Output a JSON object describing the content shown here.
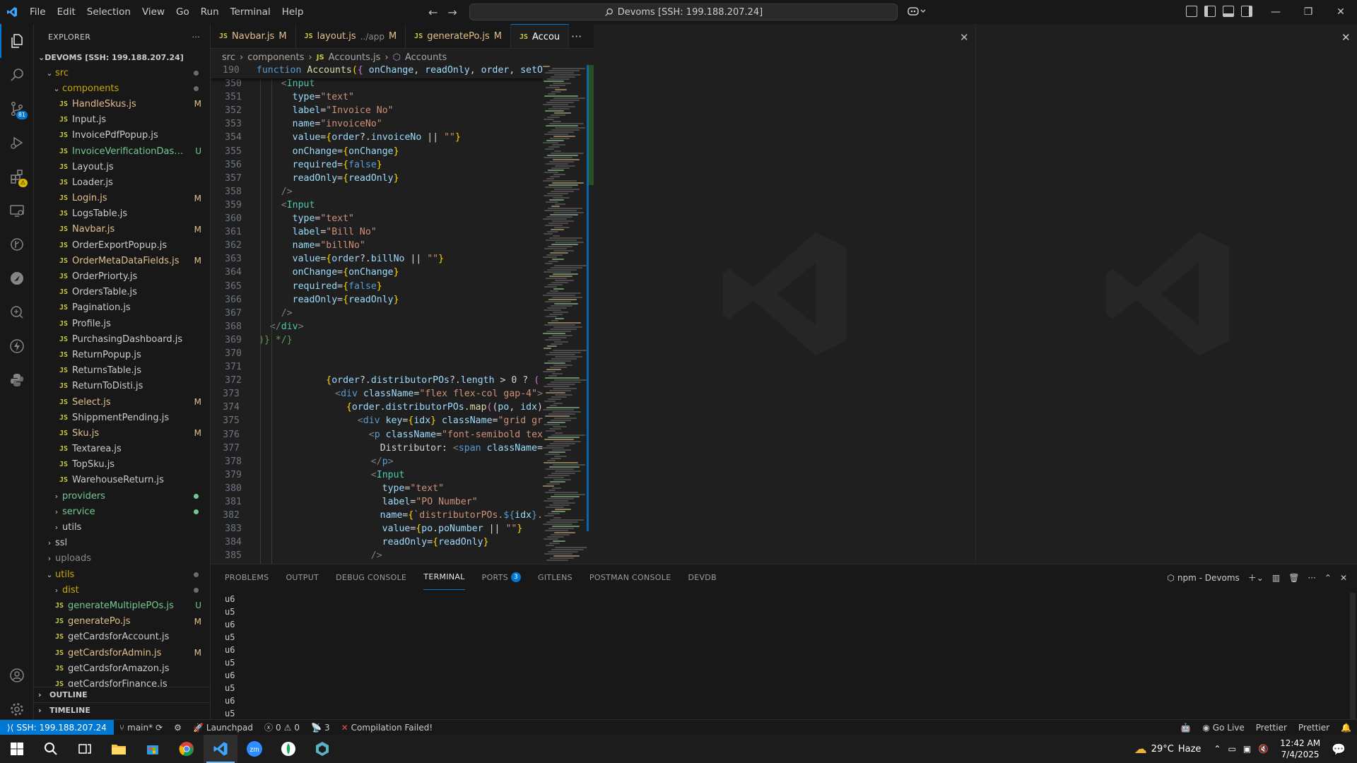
{
  "menu": [
    "File",
    "Edit",
    "Selection",
    "View",
    "Go",
    "Run",
    "Terminal",
    "Help"
  ],
  "command_center": "Devoms [SSH: 199.188.207.24]",
  "activity": {
    "scm_badge": "81"
  },
  "explorer": {
    "title": "EXPLORER",
    "root": "DEVOMS [SSH: 199.188.207.24]",
    "src": "src",
    "components": "components",
    "files": [
      {
        "name": "HandleSkus.js",
        "status": "M",
        "color": "mod"
      },
      {
        "name": "Input.js",
        "status": "",
        "color": "plain"
      },
      {
        "name": "InvoicePdfPopup.js",
        "status": "",
        "color": "plain"
      },
      {
        "name": "InvoiceVerificationDashboa...",
        "status": "U",
        "color": "new"
      },
      {
        "name": "Layout.js",
        "status": "",
        "color": "plain"
      },
      {
        "name": "Loader.js",
        "status": "",
        "color": "plain"
      },
      {
        "name": "Login.js",
        "status": "M",
        "color": "mod"
      },
      {
        "name": "LogsTable.js",
        "status": "",
        "color": "plain"
      },
      {
        "name": "Navbar.js",
        "status": "M",
        "color": "mod"
      },
      {
        "name": "OrderExportPopup.js",
        "status": "",
        "color": "plain"
      },
      {
        "name": "OrderMetaDataFields.js",
        "status": "M",
        "color": "mod"
      },
      {
        "name": "OrderPriorty.js",
        "status": "",
        "color": "plain"
      },
      {
        "name": "OrdersTable.js",
        "status": "",
        "color": "plain"
      },
      {
        "name": "Pagination.js",
        "status": "",
        "color": "plain"
      },
      {
        "name": "Profile.js",
        "status": "",
        "color": "plain"
      },
      {
        "name": "PurchasingDashboard.js",
        "status": "",
        "color": "plain"
      },
      {
        "name": "ReturnPopup.js",
        "status": "",
        "color": "plain"
      },
      {
        "name": "ReturnsTable.js",
        "status": "",
        "color": "plain"
      },
      {
        "name": "ReturnToDisti.js",
        "status": "",
        "color": "plain"
      },
      {
        "name": "Select.js",
        "status": "M",
        "color": "mod"
      },
      {
        "name": "ShippmentPending.js",
        "status": "",
        "color": "plain"
      },
      {
        "name": "Sku.js",
        "status": "M",
        "color": "mod"
      },
      {
        "name": "Textarea.js",
        "status": "",
        "color": "plain"
      },
      {
        "name": "TopSku.js",
        "status": "",
        "color": "plain"
      },
      {
        "name": "WarehouseReturn.js",
        "status": "",
        "color": "plain"
      }
    ],
    "providers": "providers",
    "service": "service",
    "utils_inner": "utils",
    "ssl": "ssl",
    "uploads": "uploads",
    "utils": "utils",
    "dist": "dist",
    "util_files": [
      {
        "name": "generateMultiplePOs.js",
        "status": "U",
        "color": "new"
      },
      {
        "name": "generatePo.js",
        "status": "M",
        "color": "mod"
      },
      {
        "name": "getCardsforAccount.js",
        "status": "",
        "color": "plain"
      },
      {
        "name": "getCardsforAdmin.js",
        "status": "M",
        "color": "mod"
      },
      {
        "name": "getCardsforAmazon.js",
        "status": "",
        "color": "plain"
      },
      {
        "name": "getCardsforFinance.js",
        "status": "",
        "color": "plain"
      }
    ],
    "outline": "OUTLINE",
    "timeline": "TIMELINE"
  },
  "tabs": [
    {
      "label": "Navbar.js",
      "status": "M"
    },
    {
      "label": "layout.js",
      "hint": "../app",
      "status": "M"
    },
    {
      "label": "generatePo.js",
      "status": "M"
    },
    {
      "label": "Accou",
      "status": ""
    }
  ],
  "breadcrumb": [
    "src",
    "components",
    "Accounts.js",
    "Accounts"
  ],
  "code": {
    "sticky_line": "190",
    "lines": [
      {
        "n": "350",
        "html": "    <span class='gray'>&lt;</span><span class='tag'>Input</span>"
      },
      {
        "n": "351",
        "html": "      <span class='attr'>type</span><span class='pun'>=</span><span class='str'>\"text\"</span>"
      },
      {
        "n": "352",
        "html": "      <span class='attr'>label</span><span class='pun'>=</span><span class='str'>\"Invoice No\"</span>"
      },
      {
        "n": "353",
        "html": "      <span class='attr'>name</span><span class='pun'>=</span><span class='str'>\"invoiceNo\"</span>"
      },
      {
        "n": "354",
        "html": "      <span class='attr'>value</span><span class='pun'>=</span><span class='brk2'>{</span><span class='var'>order</span><span class='pun'>?.</span><span class='var'>invoiceNo</span> <span class='pun'>||</span> <span class='str'>\"\"</span><span class='brk2'>}</span>"
      },
      {
        "n": "355",
        "html": "      <span class='attr'>onChange</span><span class='pun'>=</span><span class='brk2'>{</span><span class='var'>onChange</span><span class='brk2'>}</span>"
      },
      {
        "n": "356",
        "html": "      <span class='attr'>required</span><span class='pun'>=</span><span class='brk2'>{</span><span class='kw'>false</span><span class='brk2'>}</span>"
      },
      {
        "n": "357",
        "html": "      <span class='attr'>readOnly</span><span class='pun'>=</span><span class='brk2'>{</span><span class='var'>readOnly</span><span class='brk2'>}</span>"
      },
      {
        "n": "358",
        "html": "    <span class='gray'>/&gt;</span>"
      },
      {
        "n": "359",
        "html": "    <span class='gray'>&lt;</span><span class='tag'>Input</span>"
      },
      {
        "n": "360",
        "html": "      <span class='attr'>type</span><span class='pun'>=</span><span class='str'>\"text\"</span>"
      },
      {
        "n": "361",
        "html": "      <span class='attr'>label</span><span class='pun'>=</span><span class='str'>\"Bill No\"</span>"
      },
      {
        "n": "362",
        "html": "      <span class='attr'>name</span><span class='pun'>=</span><span class='str'>\"billNo\"</span>"
      },
      {
        "n": "363",
        "html": "      <span class='attr'>value</span><span class='pun'>=</span><span class='brk2'>{</span><span class='var'>order</span><span class='pun'>?.</span><span class='var'>billNo</span> <span class='pun'>||</span> <span class='str'>\"\"</span><span class='brk2'>}</span>"
      },
      {
        "n": "364",
        "html": "      <span class='attr'>onChange</span><span class='pun'>=</span><span class='brk2'>{</span><span class='var'>onChange</span><span class='brk2'>}</span>"
      },
      {
        "n": "365",
        "html": "      <span class='attr'>required</span><span class='pun'>=</span><span class='brk2'>{</span><span class='kw'>false</span><span class='brk2'>}</span>"
      },
      {
        "n": "366",
        "html": "      <span class='attr'>readOnly</span><span class='pun'>=</span><span class='brk2'>{</span><span class='var'>readOnly</span><span class='brk2'>}</span>"
      },
      {
        "n": "367",
        "html": "    <span class='gray'>/&gt;</span>"
      },
      {
        "n": "368",
        "html": "  <span class='gray'>&lt;/</span><span class='tag'>div</span><span class='gray'>&gt;</span>"
      },
      {
        "n": "369",
        "html": "<span class='cmt'>)} */}</span>"
      },
      {
        "n": "370",
        "html": ""
      },
      {
        "n": "371",
        "html": ""
      },
      {
        "n": "372",
        "html": "            <span class='brk2'>{</span><span class='var'>order</span><span class='pun'>?.</span><span class='var'>distributorPOs</span><span class='pun'>?.</span><span class='var'>length</span> <span class='pun'>&gt;</span> <span class='pun'>0</span> <span class='pun'>?</span> <span class='brk'>(</span>"
      },
      {
        "n": "373",
        "html": "              <span class='gray'>&lt;</span><span class='kw'>div</span> <span class='attr'>className</span><span class='pun'>=</span><span class='str'>\"flex flex-col gap-4\"</span><span class='gray'>&gt;</span>"
      },
      {
        "n": "374",
        "html": "                <span class='brk2'>{</span><span class='var'>order</span><span class='pun'>.</span><span class='var'>distributorPOs</span><span class='pun'>.</span><span class='fn'>map</span><span class='brk'>(</span><span class='pun'>(</span><span class='var'>po</span><span class='pun'>,</span> <span class='var'>idx</span><span class='pun'>)</span>"
      },
      {
        "n": "375",
        "html": "                  <span class='gray'>&lt;</span><span class='kw'>div</span> <span class='attr'>key</span><span class='pun'>=</span><span class='brk2'>{</span><span class='var'>idx</span><span class='brk2'>}</span> <span class='attr'>className</span><span class='pun'>=</span><span class='str'>\"grid gr</span>"
      },
      {
        "n": "376",
        "html": "                    <span class='gray'>&lt;</span><span class='kw'>p</span> <span class='attr'>className</span><span class='pun'>=</span><span class='str'>\"font-semibold tex</span>"
      },
      {
        "n": "377",
        "html": "                      <span class='pun'>Distributor: </span><span class='gray'>&lt;</span><span class='kw'>span</span> <span class='attr'>className</span><span class='pun'>=</span>"
      },
      {
        "n": "378",
        "html": "                    <span class='gray'>&lt;/</span><span class='kw'>p</span><span class='gray'>&gt;</span>"
      },
      {
        "n": "379",
        "html": "                    <span class='gray'>&lt;</span><span class='tag'>Input</span>"
      },
      {
        "n": "380",
        "html": "                      <span class='attr'>type</span><span class='pun'>=</span><span class='str'>\"text\"</span>"
      },
      {
        "n": "381",
        "html": "                      <span class='attr'>label</span><span class='pun'>=</span><span class='str'>\"PO Number\"</span>"
      },
      {
        "n": "382",
        "html": "                      <span class='attr'>name</span><span class='pun'>=</span><span class='brk2'>{</span><span class='str'>`distributorPOs.</span><span class='kw'>${</span><span class='var'>idx</span><span class='kw'>}</span><span class='str'>.</span>"
      },
      {
        "n": "383",
        "html": "                      <span class='attr'>value</span><span class='pun'>=</span><span class='brk2'>{</span><span class='var'>po</span><span class='pun'>.</span><span class='var'>poNumber</span> <span class='pun'>||</span> <span class='str'>\"\"</span><span class='brk2'>}</span>"
      },
      {
        "n": "384",
        "html": "                      <span class='attr'>readOnly</span><span class='pun'>=</span><span class='brk2'>{</span><span class='var'>readOnly</span><span class='brk2'>}</span>"
      },
      {
        "n": "385",
        "html": "                    <span class='gray'>/&gt;</span>"
      }
    ]
  },
  "panel": {
    "tabs": [
      "PROBLEMS",
      "OUTPUT",
      "DEBUG CONSOLE",
      "TERMINAL",
      "PORTS",
      "GITLENS",
      "POSTMAN CONSOLE",
      "DEVDB"
    ],
    "ports_badge": "3",
    "terminal_name": "npm - Devoms",
    "output": [
      "u6",
      "u5",
      "u6",
      "u5",
      "u6",
      "u5",
      "u6",
      "u5",
      "u6",
      "u5"
    ]
  },
  "status": {
    "remote": "SSH: 199.188.207.24",
    "branch": "main*",
    "launchpad": "Launchpad",
    "errors": "0",
    "warnings": "0",
    "ports": "3",
    "compile": "Compilation Failed!",
    "golive": "Go Live",
    "prettier1": "Prettier",
    "prettier2": "Prettier"
  },
  "taskbar": {
    "temp": "29°C",
    "weather": "Haze",
    "time": "12:42 AM",
    "date": "7/4/2025"
  }
}
